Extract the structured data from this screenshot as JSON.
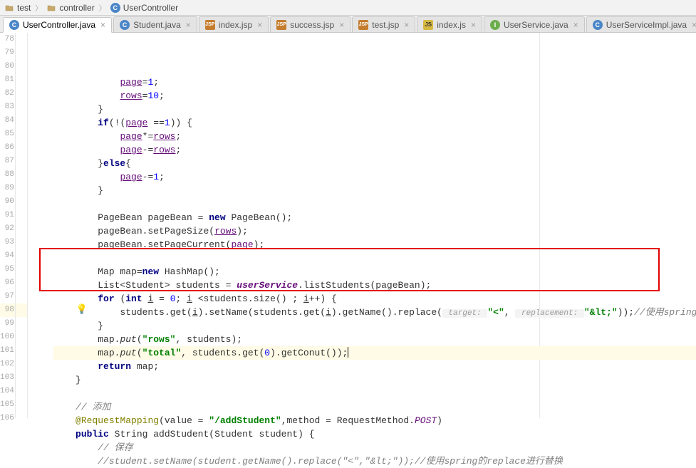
{
  "breadcrumb": {
    "items": [
      {
        "icon": "folder",
        "label": "test"
      },
      {
        "icon": "folder",
        "label": "controller"
      },
      {
        "icon": "class",
        "label": "UserController"
      }
    ]
  },
  "tabs": [
    {
      "icon": "java-c",
      "glyph": "C",
      "label": "UserController.java",
      "active": true
    },
    {
      "icon": "java-c",
      "glyph": "C",
      "label": "Student.java",
      "active": false
    },
    {
      "icon": "jsp",
      "glyph": "JSP",
      "label": "index.jsp",
      "active": false
    },
    {
      "icon": "jsp",
      "glyph": "JSP",
      "label": "success.jsp",
      "active": false
    },
    {
      "icon": "jsp",
      "glyph": "JSP",
      "label": "test.jsp",
      "active": false
    },
    {
      "icon": "js",
      "glyph": "JS",
      "label": "index.js",
      "active": false
    },
    {
      "icon": "java-i",
      "glyph": "I",
      "label": "UserService.java",
      "active": false
    },
    {
      "icon": "java-c",
      "glyph": "C",
      "label": "UserServiceImpl.java",
      "active": false
    }
  ],
  "line_start": 78,
  "line_end": 106,
  "caret_line": 98,
  "code": {
    "78": [
      [
        "",
        "            "
      ],
      [
        "field underline",
        "page"
      ],
      [
        "",
        "="
      ],
      [
        "num",
        "1"
      ],
      [
        "",
        ";"
      ]
    ],
    "79": [
      [
        "",
        "            "
      ],
      [
        "field underline",
        "rows"
      ],
      [
        "",
        "="
      ],
      [
        "num",
        "10"
      ],
      [
        "",
        ";"
      ]
    ],
    "80": [
      [
        "",
        "        }"
      ]
    ],
    "81": [
      [
        "",
        "        "
      ],
      [
        "kw",
        "if"
      ],
      [
        "",
        "(!("
      ],
      [
        "field underline",
        "page"
      ],
      [
        "",
        " =="
      ],
      [
        "num",
        "1"
      ],
      [
        "",
        ")) {"
      ]
    ],
    "82": [
      [
        "",
        "            "
      ],
      [
        "field underline",
        "page"
      ],
      [
        "",
        "*="
      ],
      [
        "field underline",
        "rows"
      ],
      [
        "",
        ";"
      ]
    ],
    "83": [
      [
        "",
        "            "
      ],
      [
        "field underline",
        "page"
      ],
      [
        "",
        "-="
      ],
      [
        "field underline",
        "rows"
      ],
      [
        "",
        ";"
      ]
    ],
    "84": [
      [
        "",
        "        }"
      ],
      [
        "kw",
        "else"
      ],
      [
        "",
        "{"
      ]
    ],
    "85": [
      [
        "",
        "            "
      ],
      [
        "field underline",
        "page"
      ],
      [
        "",
        "-="
      ],
      [
        "num",
        "1"
      ],
      [
        "",
        ";"
      ]
    ],
    "86": [
      [
        "",
        "        }"
      ]
    ],
    "87": [
      [
        "",
        ""
      ]
    ],
    "88": [
      [
        "",
        "        PageBean pageBean = "
      ],
      [
        "kw",
        "new"
      ],
      [
        "",
        " PageBean();"
      ]
    ],
    "89": [
      [
        "",
        "        pageBean.setPageSize("
      ],
      [
        "field underline",
        "rows"
      ],
      [
        "",
        ");"
      ]
    ],
    "90": [
      [
        "",
        "        pageBean.setPageCurrent("
      ],
      [
        "field underline",
        "page"
      ],
      [
        "",
        ");"
      ]
    ],
    "91": [
      [
        "",
        ""
      ]
    ],
    "92": [
      [
        "",
        "        Map map="
      ],
      [
        "kw",
        "new"
      ],
      [
        "",
        " HashMap();"
      ]
    ],
    "93": [
      [
        "",
        "        List<Student> students = "
      ],
      [
        "purplebold",
        "userService"
      ],
      [
        "",
        ".listStudents(pageBean);"
      ]
    ],
    "94": [
      [
        "",
        "        "
      ],
      [
        "kw",
        "for"
      ],
      [
        "",
        " ("
      ],
      [
        "kw",
        "int"
      ],
      [
        "",
        " "
      ],
      [
        "underline",
        "i"
      ],
      [
        "",
        " = "
      ],
      [
        "num",
        "0"
      ],
      [
        "",
        "; "
      ],
      [
        "underline",
        "i"
      ],
      [
        "",
        " <students.size() ; "
      ],
      [
        "underline",
        "i"
      ],
      [
        "",
        "++) {"
      ]
    ],
    "95": [
      [
        "",
        "            students.get("
      ],
      [
        "underline",
        "i"
      ],
      [
        "",
        ").setName(students.get("
      ],
      [
        "underline",
        "i"
      ],
      [
        "",
        ").getName().replace("
      ],
      [
        "param-hint",
        " target: "
      ],
      [
        "str",
        "\"<\""
      ],
      [
        "",
        ", "
      ],
      [
        "param-hint",
        " replacement: "
      ],
      [
        "str",
        "\"&lt;\""
      ],
      [
        "",
        "));"
      ],
      [
        "comment",
        "//使用spring的replace进行替换"
      ]
    ],
    "96": [
      [
        "",
        "        }"
      ]
    ],
    "97": [
      [
        "",
        "        map."
      ],
      [
        "callItalic",
        "put"
      ],
      [
        "",
        "("
      ],
      [
        "str",
        "\"rows\""
      ],
      [
        "",
        ", students);"
      ]
    ],
    "98": [
      [
        "",
        "        map."
      ],
      [
        "callItalic",
        "put"
      ],
      [
        "",
        "("
      ],
      [
        "str",
        "\"total\""
      ],
      [
        "",
        ", students.get("
      ],
      [
        "num",
        "0"
      ],
      [
        "",
        ").getConut());"
      ]
    ],
    "99": [
      [
        "",
        "        "
      ],
      [
        "kw",
        "return"
      ],
      [
        "",
        " map;"
      ]
    ],
    "100": [
      [
        "",
        "    }"
      ]
    ],
    "101": [
      [
        "",
        ""
      ]
    ],
    "102": [
      [
        "",
        "    "
      ],
      [
        "comment",
        "// 添加"
      ]
    ],
    "103": [
      [
        "",
        "    "
      ],
      [
        "annot",
        "@RequestMapping"
      ],
      [
        "",
        "(value = "
      ],
      [
        "annot-val",
        "\"/addStudent\""
      ],
      [
        "",
        ",method = RequestMethod."
      ],
      [
        "field callItalic",
        "POST"
      ],
      [
        "",
        ")"
      ]
    ],
    "104": [
      [
        "",
        "    "
      ],
      [
        "kw",
        "public"
      ],
      [
        "",
        " String addStudent(Student student) {"
      ]
    ],
    "105": [
      [
        "",
        "        "
      ],
      [
        "comment",
        "// 保存"
      ]
    ],
    "106": [
      [
        "",
        "        "
      ],
      [
        "comment",
        "//student.setName(student.getName().replace(\"<\",\"&lt;\"));//使用spring的replace进行替换"
      ]
    ]
  },
  "redbox": {
    "top_line": 94,
    "bottom_line": 96
  }
}
